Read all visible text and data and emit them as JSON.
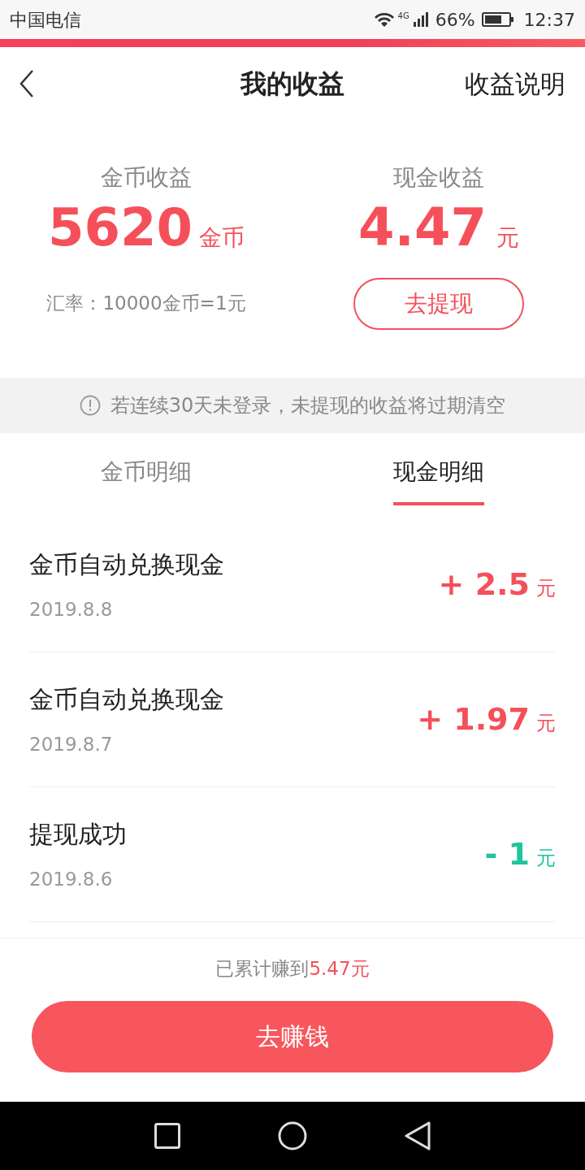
{
  "status_bar": {
    "carrier": "中国电信",
    "network": "4G",
    "battery": "66%",
    "time": "12:37"
  },
  "header": {
    "title": "我的收益",
    "link": "收益说明"
  },
  "coin": {
    "label": "金币收益",
    "value": "5620",
    "unit": "金币",
    "rate": "汇率：10000金币=1元"
  },
  "cash": {
    "label": "现金收益",
    "value": "4.47",
    "unit": "元",
    "button": "去提现"
  },
  "notice": "若连续30天未登录，未提现的收益将过期清空",
  "tabs": [
    {
      "label": "金币明细",
      "selected": false
    },
    {
      "label": "现金明细",
      "selected": true
    }
  ],
  "records": [
    {
      "title": "金币自动兑换现金",
      "date": "2019.8.8",
      "amount": "+ 2.5",
      "unit": "元",
      "kind": "income"
    },
    {
      "title": "金币自动兑换现金",
      "date": "2019.8.7",
      "amount": "+ 1.97",
      "unit": "元",
      "kind": "income"
    },
    {
      "title": "提现成功",
      "date": "2019.8.6",
      "amount": "- 1",
      "unit": "元",
      "kind": "expense"
    }
  ],
  "footer": {
    "summary": "已累计赚到",
    "total": "5.47元",
    "button": "去赚钱"
  }
}
